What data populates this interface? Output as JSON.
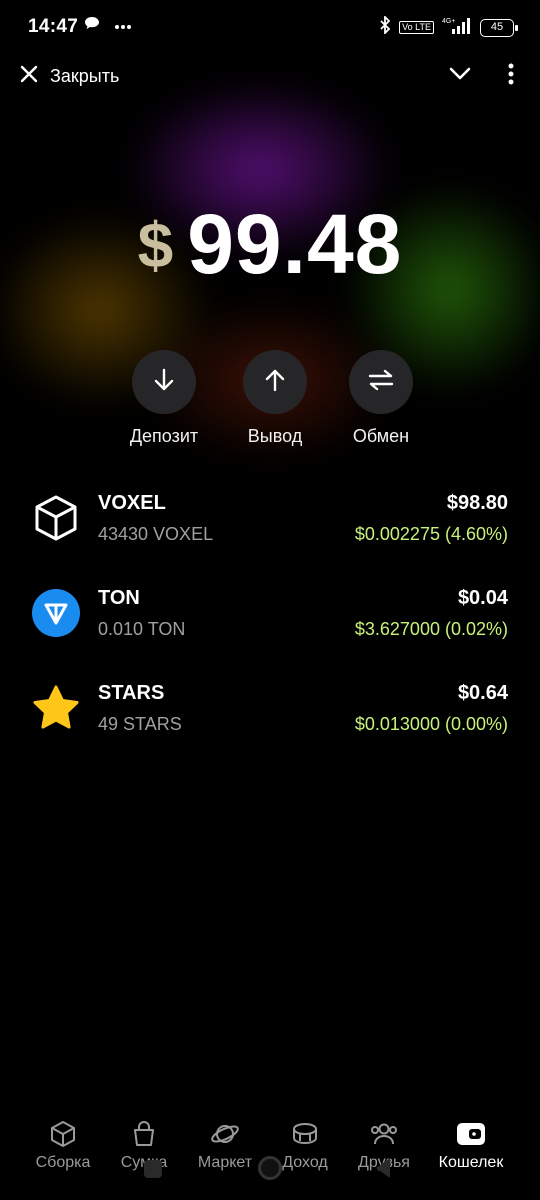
{
  "status_bar": {
    "time": "14:47",
    "battery": "45",
    "network": "4G+",
    "lte": "Vo LTE"
  },
  "header": {
    "close_label": "Закрыть"
  },
  "balance": {
    "currency": "$",
    "amount": "99.48"
  },
  "actions": [
    {
      "label": "Депозит",
      "icon": "arrow-down-icon"
    },
    {
      "label": "Вывод",
      "icon": "arrow-up-icon"
    },
    {
      "label": "Обмен",
      "icon": "swap-icon"
    }
  ],
  "tokens": [
    {
      "name": "VOXEL",
      "amount": "43430 VOXEL",
      "value": "$98.80",
      "change": "$0.002275 (4.60%)",
      "icon": "cube-icon"
    },
    {
      "name": "TON",
      "amount": "0.010 TON",
      "value": "$0.04",
      "change": "$3.627000 (0.02%)",
      "icon": "ton-icon"
    },
    {
      "name": "STARS",
      "amount": "49 STARS",
      "value": "$0.64",
      "change": "$0.013000 (0.00%)",
      "icon": "star-icon"
    }
  ],
  "nav": [
    {
      "label": "Сборка",
      "icon": "cube-icon",
      "active": false
    },
    {
      "label": "Сумка",
      "icon": "bag-icon",
      "active": false
    },
    {
      "label": "Маркет",
      "icon": "planet-icon",
      "active": false
    },
    {
      "label": "Доход",
      "icon": "coins-icon",
      "active": false
    },
    {
      "label": "Друзья",
      "icon": "friends-icon",
      "active": false
    },
    {
      "label": "Кошелек",
      "icon": "wallet-icon",
      "active": true
    }
  ],
  "colors": {
    "background": "#000000",
    "change_positive": "#c8f27a",
    "currency_sign": "#c9bf9f",
    "action_bg": "#262628",
    "ton_blue": "#1a8cf0",
    "star_yellow": "#ffc61a"
  }
}
